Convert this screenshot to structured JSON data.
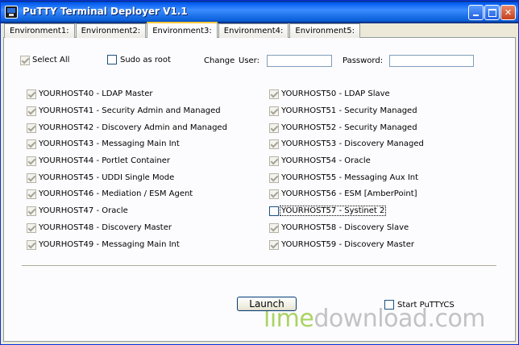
{
  "window": {
    "title": "PuTTY Terminal Deployer V1.1"
  },
  "tabs": [
    "Environment1:",
    "Environment2:",
    "Environment3:",
    "Environment4:",
    "Environment5:"
  ],
  "active_tab": "Environment3:",
  "options": {
    "select_all_label": "Select All",
    "select_all_checked": true,
    "sudo_label": "Sudo as root",
    "sudo_checked": false,
    "change_label": "Change",
    "user_label": "User:",
    "user_value": "",
    "password_label": "Password:",
    "password_value": ""
  },
  "hosts_left": [
    {
      "label": "YOURHOST40 - LDAP Master",
      "checked": true
    },
    {
      "label": "YOURHOST41 - Security Admin and Managed",
      "checked": true
    },
    {
      "label": "YOURHOST42 - Discovery Admin and Managed",
      "checked": true
    },
    {
      "label": "YOURHOST43 - Messaging Main Int",
      "checked": true
    },
    {
      "label": "YOURHOST44 - Portlet Container",
      "checked": true
    },
    {
      "label": "YOURHOST45 - UDDI Single Mode",
      "checked": true
    },
    {
      "label": "YOURHOST46 - Mediation / ESM Agent",
      "checked": true
    },
    {
      "label": "YOURHOST47 - Oracle",
      "checked": true
    },
    {
      "label": "YOURHOST48 - Discovery Master",
      "checked": true
    },
    {
      "label": "YOURHOST49 - Messaging Main Int",
      "checked": true
    }
  ],
  "hosts_right": [
    {
      "label": "YOURHOST50 - LDAP Slave",
      "checked": true
    },
    {
      "label": "YOURHOST51 - Security Managed",
      "checked": true
    },
    {
      "label": "YOURHOST52 - Security Managed",
      "checked": true
    },
    {
      "label": "YOURHOST53 - Discovery Managed",
      "checked": true
    },
    {
      "label": "YOURHOST54 - Oracle",
      "checked": true
    },
    {
      "label": "YOURHOST55 - Messaging Aux Int",
      "checked": true
    },
    {
      "label": "YOURHOST56 - ESM [AmberPoint]",
      "checked": true
    },
    {
      "label": "YOURHOST57 - Systinet 2",
      "checked": false
    },
    {
      "label": "YOURHOST58 - Discovery Slave",
      "checked": true
    },
    {
      "label": "YOURHOST59 - Discovery Master",
      "checked": true
    }
  ],
  "footer": {
    "launch_label": "Launch",
    "start_puttycs_label": "Start PuTTYCS",
    "start_puttycs_checked": false
  },
  "watermark": {
    "part1": "lime",
    "part2": "download.com"
  }
}
